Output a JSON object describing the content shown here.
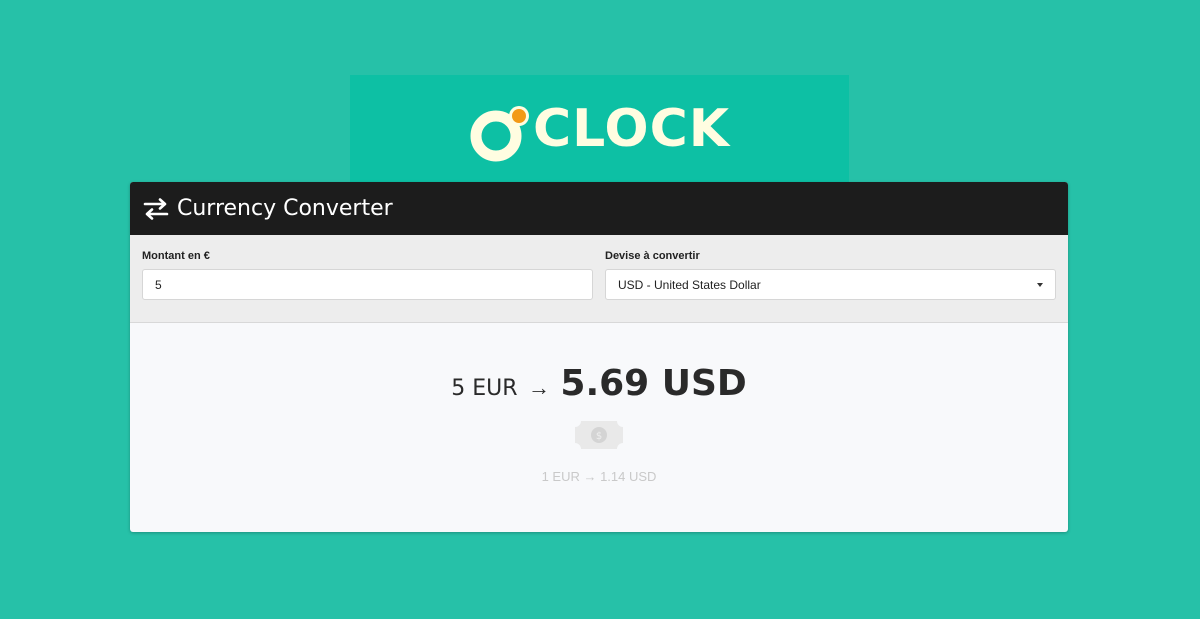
{
  "brand": {
    "logo_text": "CLOCK",
    "bg_color": "#0dc0a4",
    "dot_color": "#f39a16"
  },
  "page_bg": "#26c1a8",
  "header": {
    "title": "Currency Converter",
    "icon": "swap-arrows-icon"
  },
  "form": {
    "amount_label": "Montant en €",
    "amount_value": "5",
    "currency_label": "Devise à convertir",
    "currency_selected": "USD - United States Dollar"
  },
  "result": {
    "from": "5 EUR",
    "arrow": "→",
    "to": "5.69 USD",
    "icon": "money-bill-icon",
    "rate_text": "1 EUR → 1.14 USD"
  }
}
